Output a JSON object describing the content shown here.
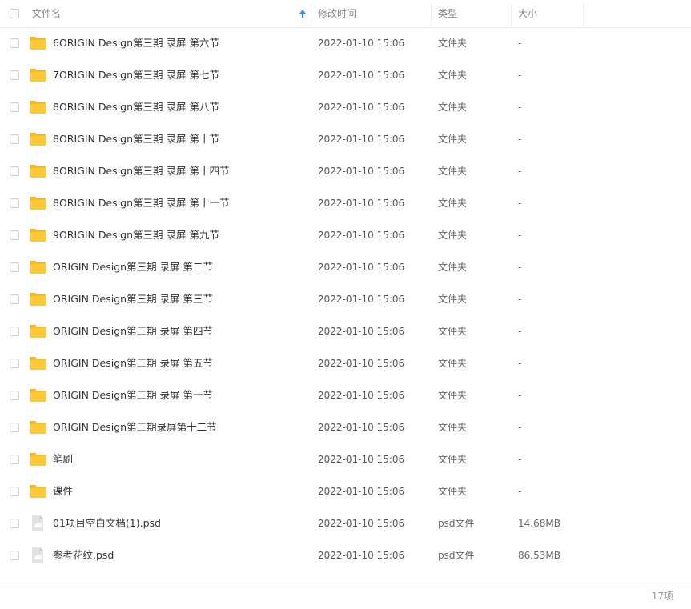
{
  "header": {
    "name": "文件名",
    "modified": "修改时间",
    "type": "类型",
    "size": "大小",
    "sort_icon": "arrow-up-icon"
  },
  "files": [
    {
      "name": "6ORIGIN Design第三期 录屏 第六节",
      "modified": "2022-01-10 15:06",
      "type": "文件夹",
      "size": "-",
      "icon": "folder-icon"
    },
    {
      "name": "7ORIGIN Design第三期 录屏 第七节",
      "modified": "2022-01-10 15:06",
      "type": "文件夹",
      "size": "-",
      "icon": "folder-icon"
    },
    {
      "name": "8ORIGIN Design第三期 录屏 第八节",
      "modified": "2022-01-10 15:06",
      "type": "文件夹",
      "size": "-",
      "icon": "folder-icon"
    },
    {
      "name": "8ORIGIN Design第三期 录屏 第十节",
      "modified": "2022-01-10 15:06",
      "type": "文件夹",
      "size": "-",
      "icon": "folder-icon"
    },
    {
      "name": "8ORIGIN Design第三期 录屏 第十四节",
      "modified": "2022-01-10 15:06",
      "type": "文件夹",
      "size": "-",
      "icon": "folder-icon"
    },
    {
      "name": "8ORIGIN Design第三期 录屏 第十一节",
      "modified": "2022-01-10 15:06",
      "type": "文件夹",
      "size": "-",
      "icon": "folder-icon"
    },
    {
      "name": "9ORIGIN Design第三期 录屏 第九节",
      "modified": "2022-01-10 15:06",
      "type": "文件夹",
      "size": "-",
      "icon": "folder-icon"
    },
    {
      "name": "ORIGIN Design第三期 录屏 第二节",
      "modified": "2022-01-10 15:06",
      "type": "文件夹",
      "size": "-",
      "icon": "folder-icon"
    },
    {
      "name": "ORIGIN Design第三期 录屏 第三节",
      "modified": "2022-01-10 15:06",
      "type": "文件夹",
      "size": "-",
      "icon": "folder-icon"
    },
    {
      "name": "ORIGIN Design第三期 录屏 第四节",
      "modified": "2022-01-10 15:06",
      "type": "文件夹",
      "size": "-",
      "icon": "folder-icon"
    },
    {
      "name": "ORIGIN Design第三期 录屏 第五节",
      "modified": "2022-01-10 15:06",
      "type": "文件夹",
      "size": "-",
      "icon": "folder-icon"
    },
    {
      "name": "ORIGIN Design第三期 录屏 第一节",
      "modified": "2022-01-10 15:06",
      "type": "文件夹",
      "size": "-",
      "icon": "folder-icon"
    },
    {
      "name": "ORIGIN Design第三期录屏第十二节",
      "modified": "2022-01-10 15:06",
      "type": "文件夹",
      "size": "-",
      "icon": "folder-icon"
    },
    {
      "name": "笔刷",
      "modified": "2022-01-10 15:06",
      "type": "文件夹",
      "size": "-",
      "icon": "folder-icon"
    },
    {
      "name": "课件",
      "modified": "2022-01-10 15:06",
      "type": "文件夹",
      "size": "-",
      "icon": "folder-icon"
    },
    {
      "name": "01项目空白文档(1).psd",
      "modified": "2022-01-10 15:06",
      "type": "psd文件",
      "size": "14.68MB",
      "icon": "image-file-icon"
    },
    {
      "name": "参考花纹.psd",
      "modified": "2022-01-10 15:06",
      "type": "psd文件",
      "size": "86.53MB",
      "icon": "image-file-icon"
    }
  ],
  "footer": {
    "count": "17项"
  },
  "colors": {
    "folder": "#ffc93a",
    "folder_tab": "#f5b823",
    "file_icon": "#d9d9d9",
    "sort_arrow": "#2f8ef7"
  }
}
